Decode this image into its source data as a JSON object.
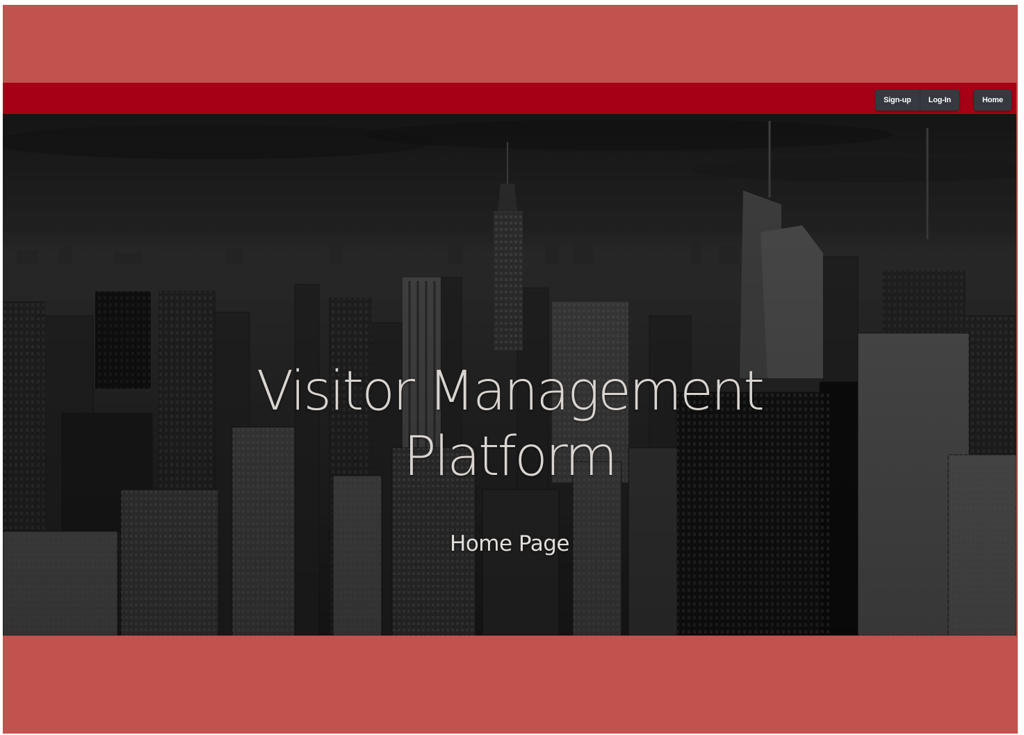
{
  "navbar": {
    "signup_label": "Sign-up",
    "login_label": "Log-In",
    "home_label": "Home"
  },
  "hero": {
    "title_line1": "Visitor Management",
    "title_line2": "Platform",
    "subtitle": "Home Page"
  },
  "colors": {
    "page_background": "#c1524d",
    "navbar_background": "#a50016",
    "button_background": "#343a40",
    "hero_text": "#d9d4cf"
  }
}
